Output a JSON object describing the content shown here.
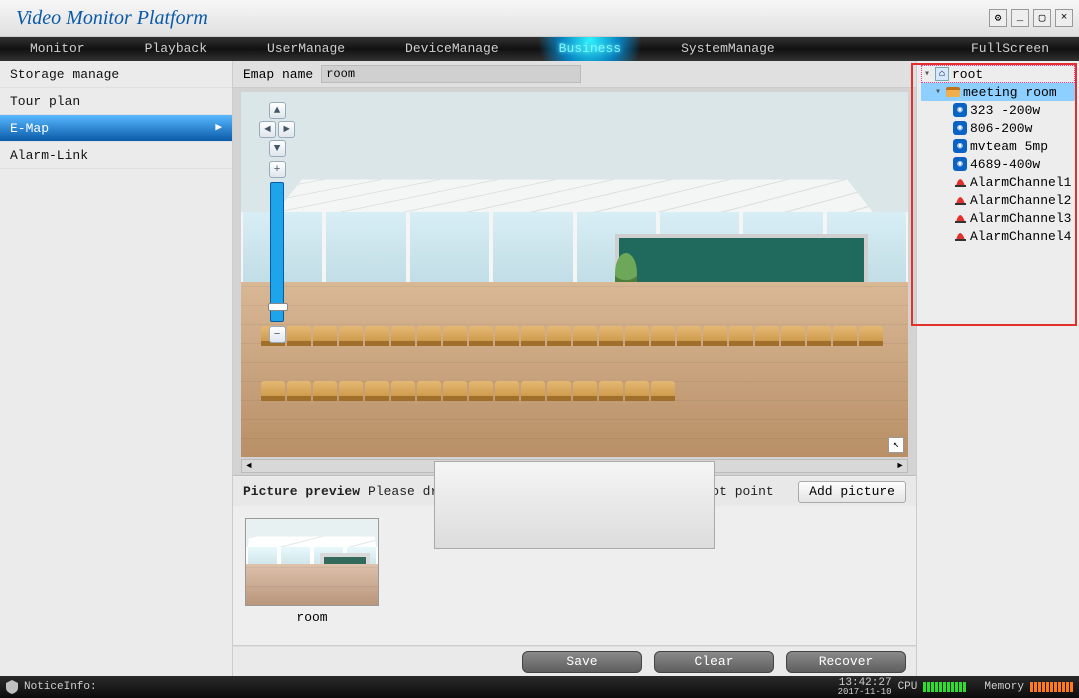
{
  "app_title": "Video Monitor Platform",
  "window_buttons": {
    "tool": "⚙",
    "min": "_",
    "max": "▢",
    "close": "×"
  },
  "mainnav": {
    "items": [
      "Monitor",
      "Playback",
      "UserManage",
      "DeviceManage",
      "Business",
      "SystemManage",
      "FullScreen"
    ],
    "active_index": 4
  },
  "sidebar": {
    "items": [
      {
        "label": "Storage manage"
      },
      {
        "label": "Tour plan"
      },
      {
        "label": "E-Map",
        "active": true
      },
      {
        "label": "Alarm-Link"
      }
    ]
  },
  "emap": {
    "label": "Emap name",
    "value": "room"
  },
  "zoom": {
    "compass": {
      "n": "▲",
      "s": "▼",
      "w": "◄",
      "e": "►"
    },
    "plus": "+",
    "minus": "−"
  },
  "preview": {
    "title": "Picture preview",
    "hint": "Please drag the picture to emap for adding hot point",
    "add_button": "Add picture",
    "thumbnails": [
      {
        "label": "room"
      }
    ]
  },
  "actions": {
    "save": "Save",
    "clear": "Clear",
    "recover": "Recover"
  },
  "tree": {
    "root": {
      "label": "root"
    },
    "group": {
      "label": "meeting room"
    },
    "cameras": [
      {
        "label": "323 -200w"
      },
      {
        "label": "806-200w"
      },
      {
        "label": "mvteam 5mp"
      },
      {
        "label": "4689-400w"
      }
    ],
    "alarms": [
      {
        "label": "AlarmChannel1"
      },
      {
        "label": "AlarmChannel2"
      },
      {
        "label": "AlarmChannel3"
      },
      {
        "label": "AlarmChannel4"
      }
    ]
  },
  "status": {
    "notice_label": "NoticeInfo:",
    "time": "13:42:27",
    "date": "2017-11-10",
    "cpu_label": "CPU",
    "mem_label": "Memory"
  }
}
